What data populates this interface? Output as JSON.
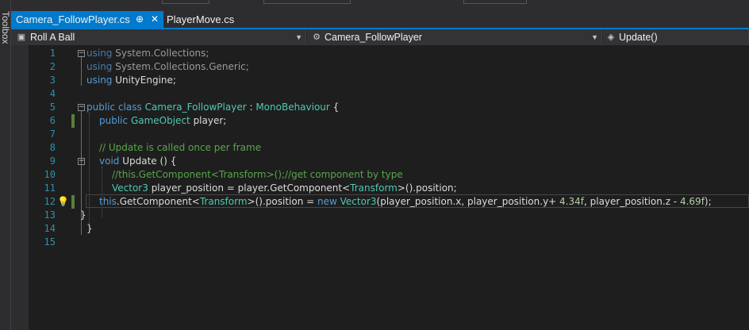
{
  "toolbox": {
    "label": "Toolbox"
  },
  "tabs": [
    {
      "label": "Camera_FollowPlayer.cs",
      "active": true,
      "pin": "⊕",
      "close": "✕"
    },
    {
      "label": "PlayerMove.cs",
      "active": false
    }
  ],
  "navbar": {
    "project": "Roll A Ball",
    "class": "Camera_FollowPlayer",
    "member": "Update()"
  },
  "editor": {
    "line_numbers": [
      "1",
      "2",
      "3",
      "4",
      "5",
      "6",
      "7",
      "8",
      "9",
      "10",
      "11",
      "12",
      "13",
      "14",
      "15"
    ],
    "lines": [
      [
        {
          "t": "using",
          "c": "kw-dim"
        },
        {
          "t": " System.Collections;",
          "c": "gray"
        }
      ],
      [
        {
          "t": "using",
          "c": "kw-dim"
        },
        {
          "t": " System.Collections.Generic;",
          "c": "gray"
        }
      ],
      [
        {
          "t": "using",
          "c": "kw"
        },
        {
          "t": " UnityEngine;",
          "c": "fn"
        }
      ],
      [],
      [
        {
          "t": "public",
          "c": "kw"
        },
        {
          "t": " ",
          "c": "fn"
        },
        {
          "t": "class",
          "c": "kw"
        },
        {
          "t": " ",
          "c": "fn"
        },
        {
          "t": "Camera_FollowPlayer",
          "c": "ty"
        },
        {
          "t": " : ",
          "c": "fn"
        },
        {
          "t": "MonoBehaviour",
          "c": "ty"
        },
        {
          "t": " {",
          "c": "fn"
        }
      ],
      [
        {
          "t": "public",
          "c": "kw"
        },
        {
          "t": " ",
          "c": "fn"
        },
        {
          "t": "GameObject",
          "c": "ty"
        },
        {
          "t": " player;",
          "c": "fn"
        }
      ],
      [],
      [
        {
          "t": "// Update is called once per frame",
          "c": "cm"
        }
      ],
      [
        {
          "t": "void",
          "c": "kw"
        },
        {
          "t": " ",
          "c": "fn"
        },
        {
          "t": "Update",
          "c": "fn"
        },
        {
          "t": " () {",
          "c": "fn"
        }
      ],
      [
        {
          "t": "//this.GetComponent<Transform>();//get component by type",
          "c": "cm"
        }
      ],
      [
        {
          "t": "Vector3",
          "c": "ty"
        },
        {
          "t": " player_position = player.GetComponent<",
          "c": "fn"
        },
        {
          "t": "Transform",
          "c": "ty"
        },
        {
          "t": ">().position;",
          "c": "fn"
        }
      ],
      [
        {
          "t": "this",
          "c": "kw"
        },
        {
          "t": ".GetComponent<",
          "c": "fn"
        },
        {
          "t": "Transform",
          "c": "ty"
        },
        {
          "t": ">().position = ",
          "c": "fn"
        },
        {
          "t": "new",
          "c": "kw"
        },
        {
          "t": " ",
          "c": "fn"
        },
        {
          "t": "Vector3",
          "c": "ty"
        },
        {
          "t": "(player_position.x, player_position.y+ ",
          "c": "fn"
        },
        {
          "t": "4.34f",
          "c": "num"
        },
        {
          "t": ", player_position.z - ",
          "c": "fn"
        },
        {
          "t": "4.69f",
          "c": "num"
        },
        {
          "t": ");",
          "c": "fn"
        }
      ],
      [
        {
          "t": "}",
          "c": "fn"
        }
      ],
      [
        {
          "t": "}",
          "c": "fn"
        }
      ],
      []
    ]
  },
  "colors": {
    "accent": "#007acc",
    "editor_bg": "#1e1e1e",
    "keyword": "#569cd6",
    "type": "#4ec9b0",
    "comment": "#57a64a",
    "line_number": "#2b91af",
    "change_marker": "#57803a"
  }
}
